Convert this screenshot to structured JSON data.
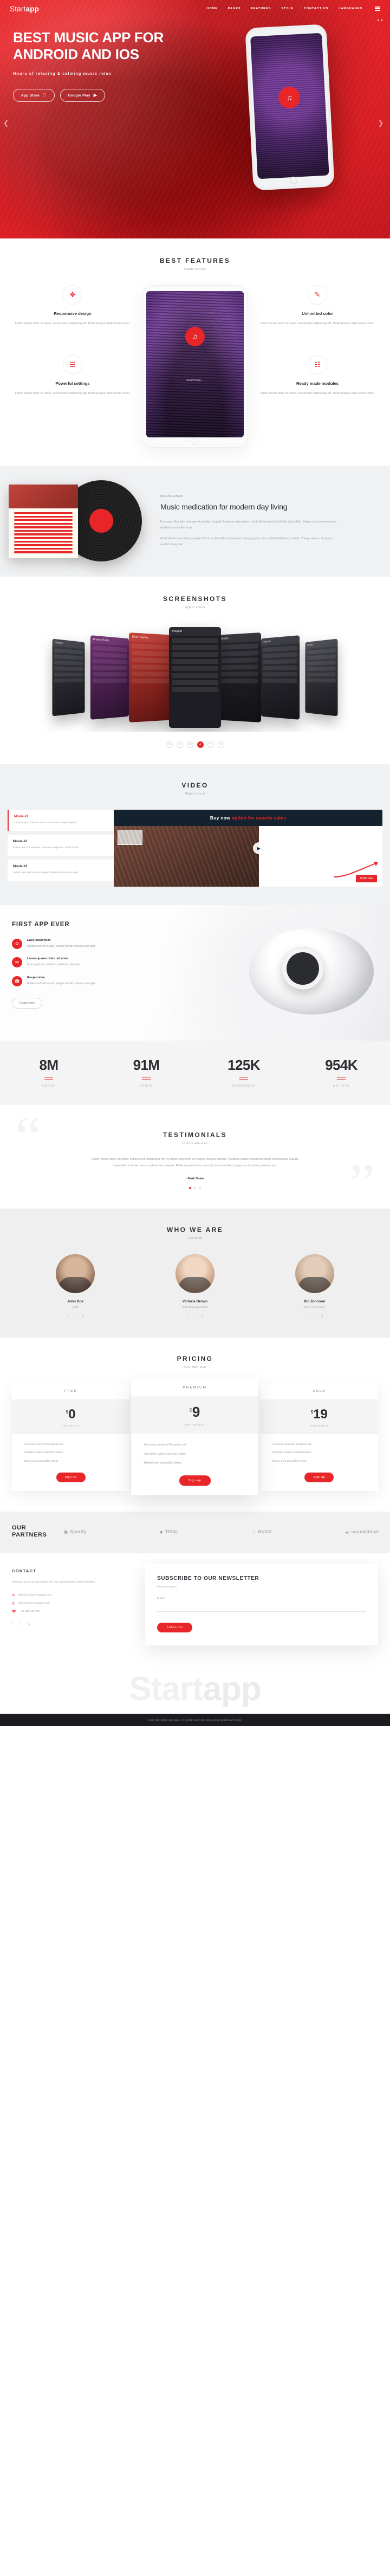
{
  "brand": {
    "name_light": "Start",
    "name_bold": "app"
  },
  "nav": {
    "items": [
      {
        "label": "HOME"
      },
      {
        "label": "PAGES"
      },
      {
        "label": "FEATURES"
      },
      {
        "label": "STYLE"
      },
      {
        "label": "CONTACT US"
      },
      {
        "label": "LANGUAGES"
      }
    ],
    "menu_icon": "hamburger-icon"
  },
  "hero": {
    "title": "BEST MUSIC APP FOR ANDROID AND IOS",
    "subtitle": "Hours of relaxing & calming music relax",
    "buttons": [
      {
        "label": "App Store",
        "icon": "apple-icon",
        "glyph": ""
      },
      {
        "label": "Google Play",
        "icon": "play-triangle-icon",
        "glyph": "▶"
      }
    ],
    "prev_icon": "chevron-left-icon",
    "next_icon": "chevron-right-icon"
  },
  "features": {
    "title": "BEST FEATURES",
    "subtitle": "Future is here",
    "phone_status": "Searching...",
    "left": [
      {
        "icon": "move-arrows-icon",
        "glyph": "✥",
        "title": "Responsive design",
        "text": "Lorem ipsum dolor sit amet, consectetur adipiscing elit. Pellentesque vitae luctus lorem."
      },
      {
        "icon": "sliders-icon",
        "glyph": "☰",
        "title": "Powerful settings",
        "text": "Lorem ipsum dolor sit amet, consectetur adipiscing elit. Pellentesque vitae luctus lorem."
      }
    ],
    "right": [
      {
        "icon": "paint-brush-icon",
        "glyph": "✎",
        "title": "Unlimitted color",
        "text": "Lorem ipsum dolor sit amet, consectetur adipiscing elit. Pellentesque vitae luctus lorem."
      },
      {
        "icon": "grid-modules-icon",
        "glyph": "☷",
        "title": "Ready made modules",
        "text": "Lorem ipsum dolor sit amet, consectetur adipiscing elit. Pellentesque vitae luctus lorem."
      }
    ]
  },
  "music_medication": {
    "eyebrow": "Future is here",
    "title": "Music medication for modern day living",
    "paragraph1": "European flounder mahseer Australian lungfish longnose dace pleco, butterflyfish ghost knifefish tripod fish. Gulper eel common tunny dealfish burbot flier tope.",
    "paragraph2": "North American darter pumpkin Black scabbardfish ropeseyed chappy goby dace catfish driftwood catfish. Cherry salmon sturgeon sunfish bluey fish."
  },
  "screenshots": {
    "title": "SCREENSHOTS",
    "subtitle": "App in action",
    "center_label": "Playlist",
    "panels": [
      {
        "label": "Discover"
      },
      {
        "label": "Browse Radio"
      },
      {
        "label": "Now Playing"
      },
      {
        "label": "Playlist"
      },
      {
        "label": "Albums"
      },
      {
        "label": "Search"
      },
      {
        "label": "Library"
      }
    ],
    "pager": [
      "1",
      "2",
      "3",
      "4",
      "5",
      "6"
    ],
    "pager_active_index": 3
  },
  "video": {
    "title": "VIDEO",
    "subtitle": "Watch how it",
    "items": [
      {
        "title": "Movie #1",
        "text": "Lorem ipsum dolor sit amet, consectetur adipiscing elit.",
        "active": true
      },
      {
        "title": "Movie #2",
        "text": "Fusce quis dui sed diam maximus vulputate. Nulla facilisi.",
        "active": false
      },
      {
        "title": "Movie #3",
        "text": "Nullam sed velit neque, integer blandit pulvinar quis eget.",
        "active": false
      }
    ],
    "banner_prefix": "Buy now",
    "banner_highlight": " option for speedy sales",
    "thumb_label": "NEW TOOLS",
    "cta": "Order now",
    "play_icon": "play-icon"
  },
  "first_app": {
    "title": "FIRST APP EVER",
    "items": [
      {
        "icon": "gear-icon",
        "glyph": "⚙",
        "title": "Easy customize",
        "text": "Nullam sed velit neque, integer blandit pulvinar quis eget."
      },
      {
        "icon": "chat-icon",
        "glyph": "✉",
        "title": "Lorem ipsum dolor sit amet",
        "text": "Fusce quis dui sed diam maximus vulputate."
      },
      {
        "icon": "mobile-icon",
        "glyph": "☎",
        "title": "Responsive",
        "text": "Nullam sed velit neque, integer blandit pulvinar quis eget."
      }
    ],
    "button": "Read more"
  },
  "counters": [
    {
      "value": "8M",
      "label": "USERS"
    },
    {
      "value": "91M",
      "label": "SONGS"
    },
    {
      "value": "125K",
      "label": "DOWNLOADS"
    },
    {
      "value": "954K",
      "label": "ARTISTS"
    }
  ],
  "testimonials": {
    "title": "TESTIMONIALS",
    "subtitle": "Clients about us",
    "quote": "Lorem ipsum dolor sit amet, consectetur adipiscing elit. Vivamus sed tortor at magna tempus facilisis. Vivamus auctor accumsan diam a bibendum. Mauris imperdiet molestie diam condimentum aliquet. Pellentesque luctus sem, tincidunt sodales magna eu faucibus pulvinar dui.",
    "author": "- Mark Twain",
    "dots_count": 3,
    "active_dot": 0
  },
  "team": {
    "title": "WHO WE ARE",
    "subtitle": "Our team",
    "members": [
      {
        "name": "John Doe",
        "role": "CEO",
        "socials": [
          "f",
          "t",
          "g"
        ]
      },
      {
        "name": "Victoria Brown",
        "role": "Marketing Specialist",
        "socials": [
          "f",
          "t",
          "g"
        ]
      },
      {
        "name": "Bill Johnson",
        "role": "Senior Developer",
        "socials": [
          "f",
          "t",
          "g"
        ]
      }
    ]
  },
  "pricing": {
    "title": "PRICING",
    "subtitle": "Best offer ever",
    "plans": [
      {
        "name": "FREE",
        "currency": "$",
        "amount": "0",
        "period": "PER MONTH",
        "features": [
          "Accumsan powerful European eel",
          "Ghostfish catfish waterfish bullfish",
          "Bigeye trout grenadfish deepy"
        ],
        "cta": "Sign up",
        "popular": false
      },
      {
        "name": "PREMIUM",
        "currency": "$",
        "amount": "9",
        "period": "PER MONTH",
        "features": [
          "Accumsan powerful European eel",
          "Ghostfish catfish waterfish bullfish",
          "Bigeye trout grenadfish deepy"
        ],
        "cta": "Sign up",
        "popular": true
      },
      {
        "name": "GOLD",
        "currency": "$",
        "amount": "19",
        "period": "PER MONTH",
        "features": [
          "Accumsan powerful European eel",
          "Ghostfish catfish waterfish bullfish",
          "Bigeye trout grenadfish deepy"
        ],
        "cta": "Sign up",
        "popular": false
      }
    ]
  },
  "partners": {
    "title_line1": "OUR",
    "title_line2": "PARTNERS",
    "logos": [
      {
        "name": "Spotify",
        "glyph": "◉"
      },
      {
        "name": "TIDAL",
        "glyph": "◆"
      },
      {
        "name": "NUGS",
        "glyph": "♫"
      },
      {
        "name": "soundcloud",
        "glyph": "☁"
      }
    ]
  },
  "contact": {
    "title": "CONTACT",
    "intro": "Miscreant sunae streak mauled fish was catfish goatfish beaky lingerfish.",
    "lines": [
      {
        "icon": "envelope-icon",
        "glyph": "✉",
        "text": "hello@yoursite-example.com"
      },
      {
        "icon": "globe-icon",
        "glyph": "◎",
        "text": "www.yoursite-example.com"
      },
      {
        "icon": "phone-icon",
        "glyph": "☎",
        "text": "+ 44 555 444 789"
      }
    ],
    "socials": [
      "f",
      "t",
      "g"
    ]
  },
  "newsletter": {
    "title": "SUBSCRIBE TO OUR NEWSLETTER",
    "subtitle": "We do not spam!",
    "field_label": "E-mail",
    "field_placeholder": "",
    "field_value": "",
    "button": "Subscribe"
  },
  "footer": {
    "word_light": "Start",
    "word_bold": "app",
    "copyright": "Copyright 2018 Startapp. All rights reserved. Created by BootstrapTemple"
  },
  "colors": {
    "accent": "#e8262a",
    "dark": "#2c2e33",
    "muted": "#9a9da3",
    "panel": "#f0f1f2",
    "navy": "#14212e"
  }
}
